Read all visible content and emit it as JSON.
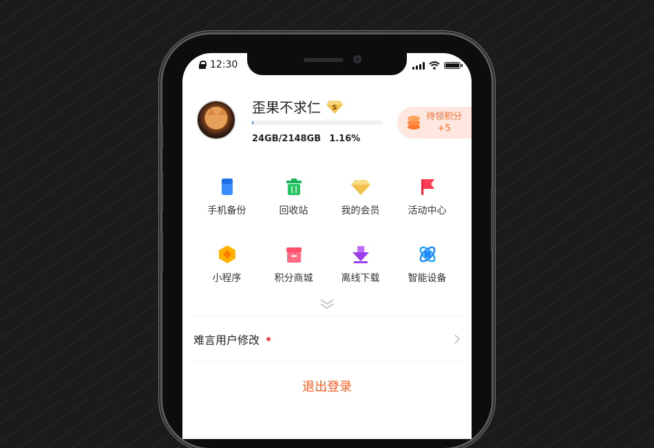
{
  "status_bar": {
    "time": "12:30"
  },
  "profile": {
    "username": "歪果不求仁",
    "vip_badge_letter": "S",
    "storage_used": "24GB/2148GB",
    "storage_percent": "1.16%",
    "storage_fraction": 0.0116
  },
  "points": {
    "label": "待领积分",
    "value": "+5"
  },
  "grid": [
    {
      "label": "手机备份",
      "icon": "phone-backup-icon"
    },
    {
      "label": "回收站",
      "icon": "trash-icon"
    },
    {
      "label": "我的会员",
      "icon": "diamond-icon"
    },
    {
      "label": "活动中心",
      "icon": "flag-icon"
    },
    {
      "label": "小程序",
      "icon": "mini-program-icon"
    },
    {
      "label": "积分商城",
      "icon": "shop-icon"
    },
    {
      "label": "离线下载",
      "icon": "download-icon"
    },
    {
      "label": "智能设备",
      "icon": "smart-device-icon"
    }
  ],
  "menu": {
    "edit_user_label": "难言用户修改"
  },
  "logout_label": "退出登录",
  "colors": {
    "accent": "#ff6b2c",
    "logout": "#ff5a1f",
    "progress": "#3b82f6",
    "dot": "#f04848"
  }
}
